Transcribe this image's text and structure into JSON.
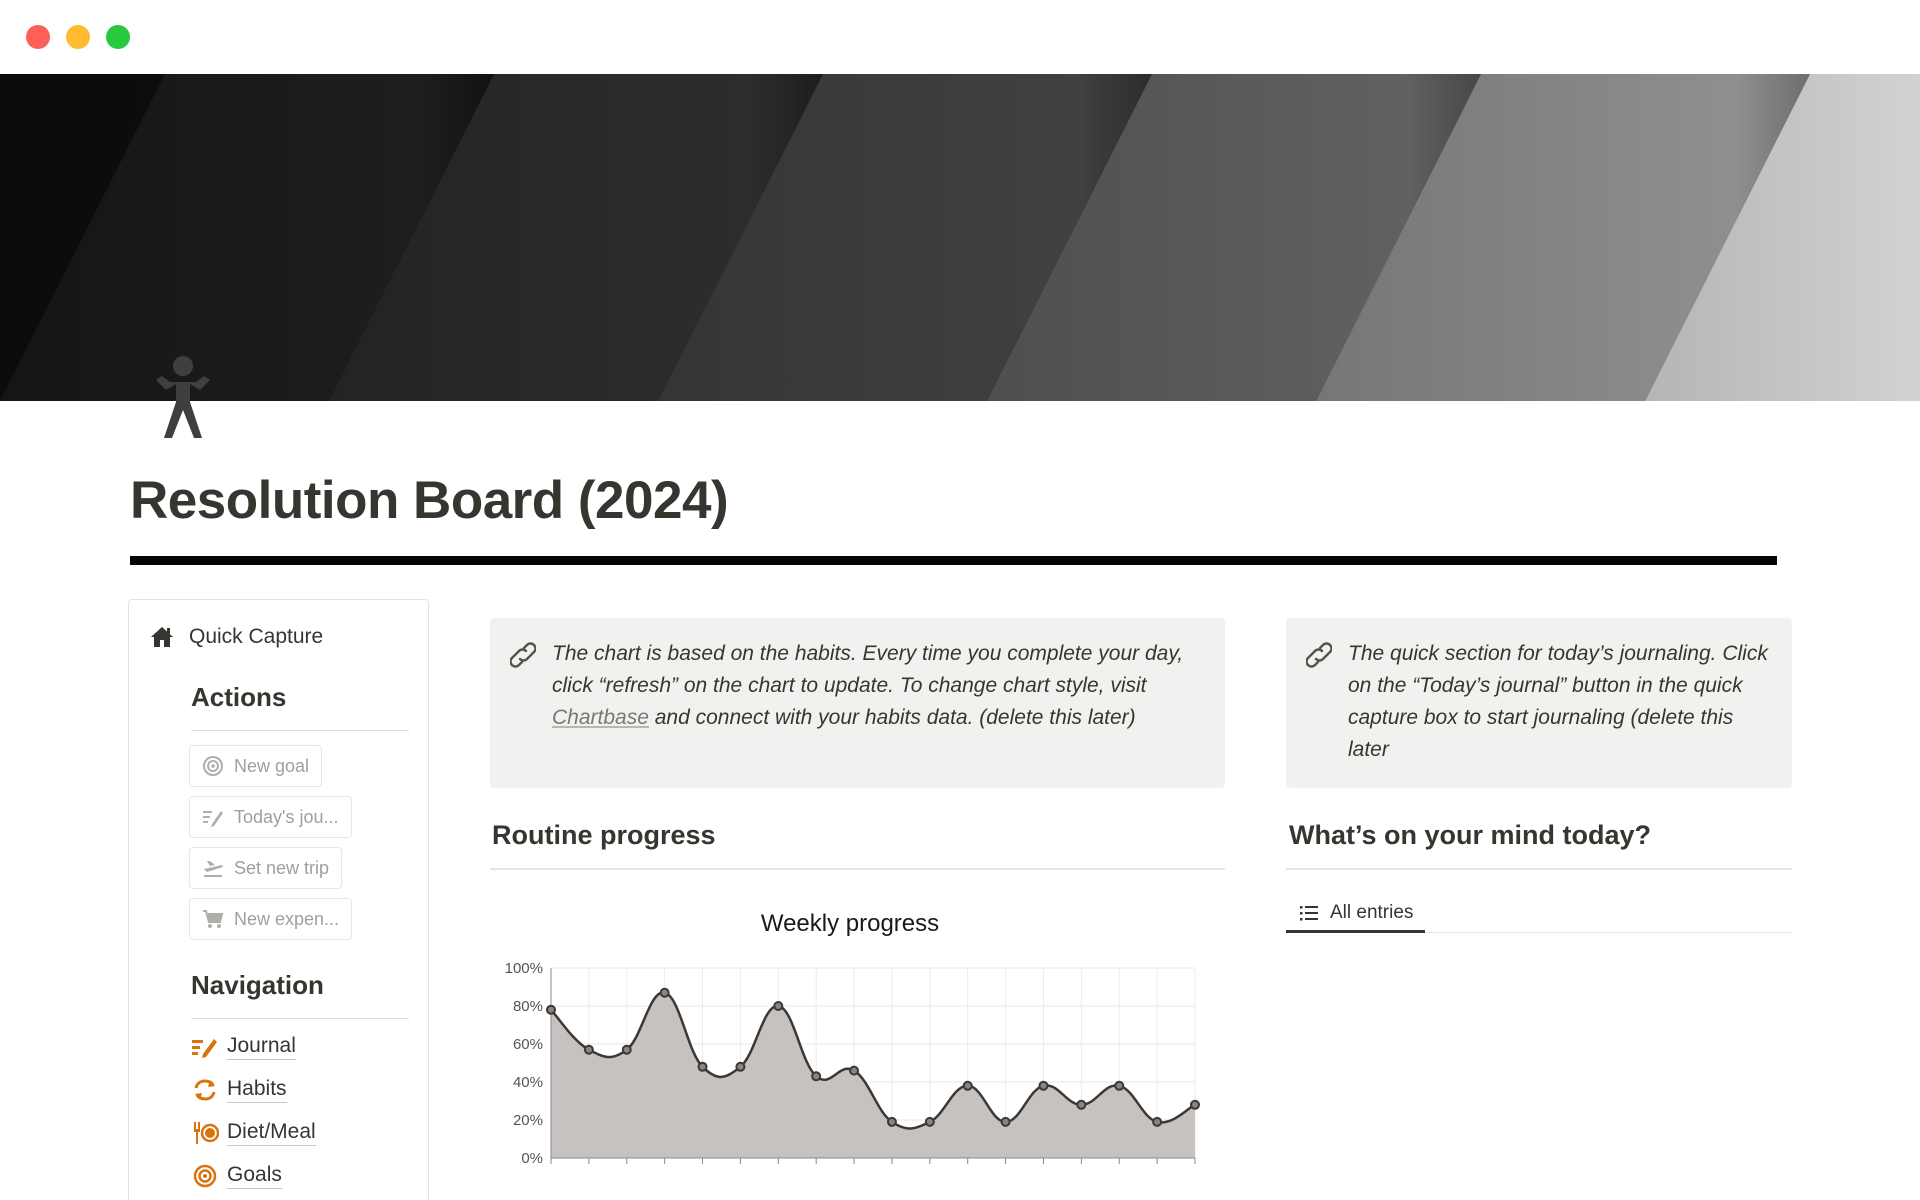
{
  "window": {
    "controls": [
      "close",
      "minimize",
      "zoom"
    ]
  },
  "cover": {
    "style": "diagonal grayscale stripes"
  },
  "page": {
    "icon": "accessibility-figure-icon",
    "title": "Resolution Board (2024)"
  },
  "sidebar": {
    "quick_capture": {
      "icon": "home-icon",
      "label": "Quick Capture"
    },
    "actions": {
      "heading": "Actions",
      "buttons": [
        {
          "icon": "target-icon",
          "label": "New goal"
        },
        {
          "icon": "pencil-lines-icon",
          "label": "Today's jou..."
        },
        {
          "icon": "airplane-icon",
          "label": "Set new trip"
        },
        {
          "icon": "cart-icon",
          "label": "New expen..."
        }
      ]
    },
    "navigation": {
      "heading": "Navigation",
      "items": [
        {
          "icon": "journal-icon",
          "label": "Journal"
        },
        {
          "icon": "refresh-icon",
          "label": "Habits"
        },
        {
          "icon": "utensils-icon",
          "label": "Diet/Meal"
        },
        {
          "icon": "target-icon",
          "label": "Goals"
        }
      ]
    }
  },
  "callouts": {
    "chart_note": {
      "icon": "paperclip-icon",
      "text_before": "The chart is based on the habits. Every time you complete your day, click “refresh” on the chart to update. To change chart style, visit ",
      "link": "Chartbase",
      "text_after": " and connect with your habits data. (delete this later)"
    },
    "journal_note": {
      "icon": "paperclip-icon",
      "text": "The quick section for today’s journaling. Click on the “Today’s journal” button in the quick capture box to start journaling (delete this later"
    }
  },
  "routine": {
    "heading": "Routine progress"
  },
  "mind": {
    "heading": "What’s on your mind today?",
    "tab": {
      "icon": "list-icon",
      "label": "All entries"
    }
  },
  "colors": {
    "line": "#3d3833",
    "fill": "#c6c2bf",
    "accent_orange": "#d9730d",
    "callout_bg": "#f1f1ef"
  },
  "chart_data": {
    "type": "area",
    "title": "Weekly progress",
    "y_tick_labels": [
      "100%",
      "80%",
      "60%",
      "40%",
      "20%",
      "0%"
    ],
    "ylim": [
      0,
      100
    ],
    "grid": true,
    "values": [
      78,
      57,
      57,
      87,
      48,
      48,
      80,
      43,
      46,
      19,
      19,
      38,
      19,
      38,
      28,
      38,
      19,
      28
    ]
  }
}
